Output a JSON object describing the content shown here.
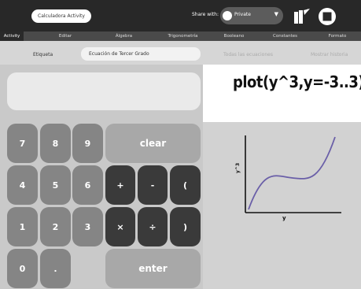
{
  "toolbar": {
    "activity_name": "Calculadora Activity",
    "share_label": "Share with:",
    "share_value": "Private"
  },
  "tabs": [
    "Activity",
    "Editar",
    "Álgebra",
    "Trigonometría",
    "Booleano",
    "Constantes",
    "Formato"
  ],
  "label_row": {
    "label": "Etiqueta",
    "input_value": "Ecuación de Tercer Grado",
    "all_equations": "Todas las ecuaciones",
    "show_history": "Mostrar historia"
  },
  "keypad": {
    "k7": "7",
    "k8": "8",
    "k9": "9",
    "k4": "4",
    "k5": "5",
    "k6": "6",
    "k1": "1",
    "k2": "2",
    "k3": "3",
    "k0": "0",
    "kdot": ".",
    "clear": "clear",
    "plus": "+",
    "minus": "-",
    "lparen": "(",
    "times": "×",
    "divide": "÷",
    "rparen": ")",
    "enter": "enter"
  },
  "result": {
    "expression": "plot(y^3,y=-3..3)"
  },
  "graph": {
    "xlabel": "y",
    "ylabel": "y^3"
  }
}
